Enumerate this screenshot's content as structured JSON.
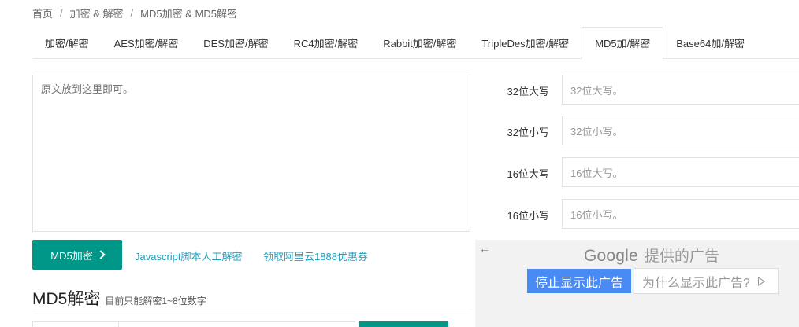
{
  "breadcrumb": {
    "items": [
      "首页",
      "加密 & 解密",
      "MD5加密 & MD5解密"
    ],
    "separator": "/"
  },
  "tabs": [
    {
      "label": "加密/解密",
      "active": false
    },
    {
      "label": "AES加密/解密",
      "active": false
    },
    {
      "label": "DES加密/解密",
      "active": false
    },
    {
      "label": "RC4加密/解密",
      "active": false
    },
    {
      "label": "Rabbit加密/解密",
      "active": false
    },
    {
      "label": "TripleDes加密/解密",
      "active": false
    },
    {
      "label": "MD5加/解密",
      "active": true
    },
    {
      "label": "Base64加/解密",
      "active": false
    }
  ],
  "source": {
    "placeholder": "原文放到这里即可。"
  },
  "results": [
    {
      "label": "32位大写",
      "placeholder": "32位大写。"
    },
    {
      "label": "32位小写",
      "placeholder": "32位小写。"
    },
    {
      "label": "16位大写",
      "placeholder": "16位大写。"
    },
    {
      "label": "16位小写",
      "placeholder": "16位小写。"
    }
  ],
  "actions": {
    "encrypt_label": "MD5加密",
    "link1": "Javascript脚本人工解密",
    "link2": "领取阿里云1888优惠券"
  },
  "decrypt": {
    "title": "MD5解密",
    "hint": "目前只能解密1~8位数字"
  },
  "ad": {
    "back": "←",
    "google": "Google",
    "provided": "提供的广告",
    "stop": "停止显示此广告",
    "why": "为什么显示此广告?"
  },
  "colors": {
    "accent": "#009688",
    "link": "#1e9fbf",
    "ad_button": "#4a8af4"
  }
}
